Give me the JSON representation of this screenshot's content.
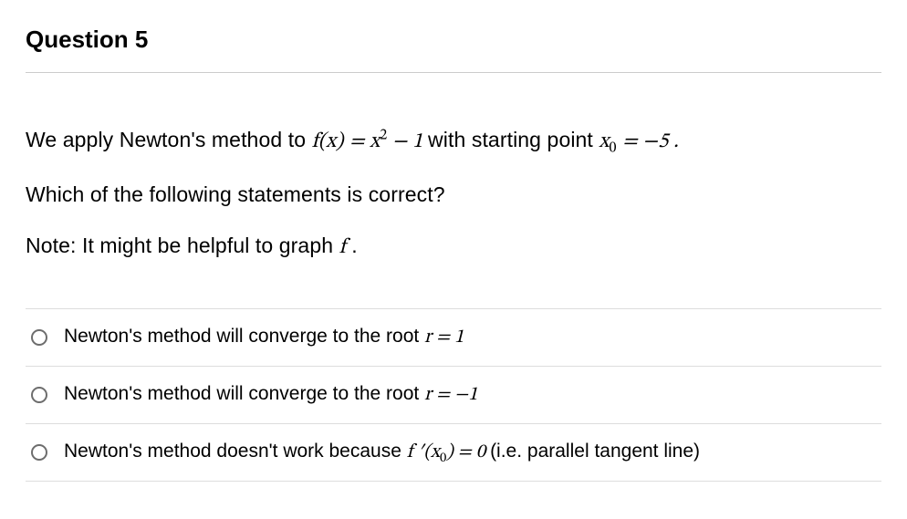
{
  "question": {
    "title": "Question 5",
    "prompt_parts": {
      "p1a": "We apply Newton's method to ",
      "p1_fx": "f(x)",
      "p1_eq": " = ",
      "p1_expr_x": "x",
      "p1_exp2": "2",
      "p1_minus1": " − 1 ",
      "p1b": " with starting point ",
      "p1_x": "x",
      "p1_sub0": "0",
      "p1_eqm5": " = −5 .",
      "p2": "Which of the following statements is correct?",
      "p3a": "Note: It might be helpful to graph ",
      "p3_f": "f",
      "p3b": " ."
    }
  },
  "options": [
    {
      "text_a": "Newton's method will converge to the root ",
      "math_r": "r",
      "math_eq": " = 1"
    },
    {
      "text_a": "Newton's method will converge to the root ",
      "math_r": "r",
      "math_eq": " = −1"
    },
    {
      "text_a": "Newton's method doesn't work because ",
      "math_fprime": "f ′",
      "math_open": "(",
      "math_x": "x",
      "math_sub0": "0",
      "math_close": ")",
      "math_eq": " = 0 ",
      "text_b": "(i.e. parallel tangent line)"
    }
  ]
}
